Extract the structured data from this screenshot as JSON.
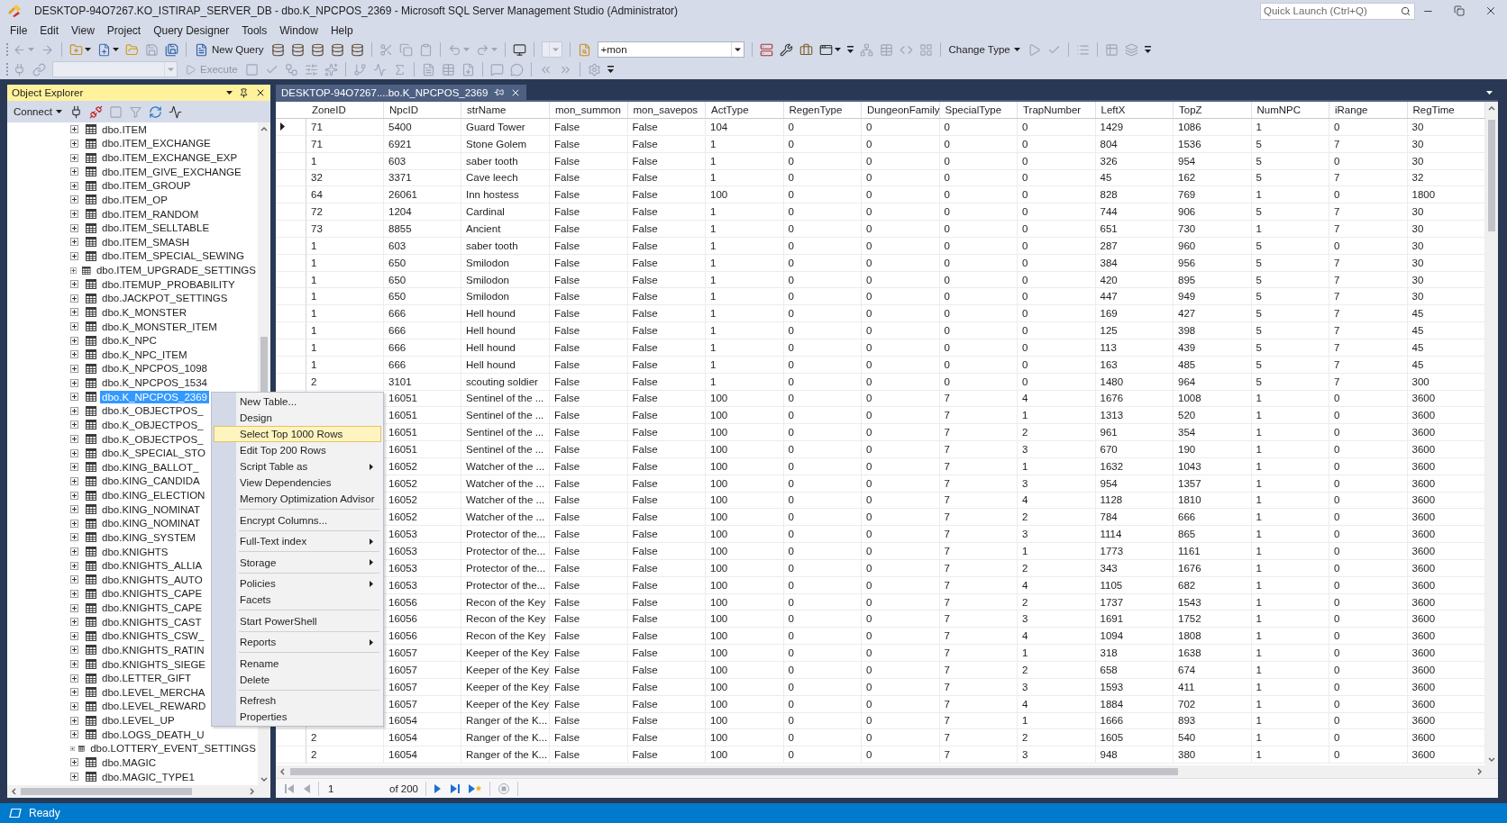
{
  "window": {
    "title": "DESKTOP-94O7267.KO_ISTIRAP_SERVER_DB - dbo.K_NPCPOS_2369 - Microsoft SQL Server Management Studio (Administrator)"
  },
  "quick_launch": {
    "placeholder": "Quick Launch (Ctrl+Q)"
  },
  "menu_bar": [
    "File",
    "Edit",
    "View",
    "Project",
    "Query Designer",
    "Tools",
    "Window",
    "Help"
  ],
  "toolbars": [
    {
      "items": [
        {
          "kind": "grip"
        },
        {
          "kind": "back",
          "disabled": true,
          "dropdown": true
        },
        {
          "kind": "forward",
          "disabled": true
        },
        {
          "kind": "separator"
        },
        {
          "kind": "newproject",
          "disabled": false,
          "dropdown": true
        },
        {
          "kind": "newitem",
          "disabled": false,
          "dropdown": true
        },
        {
          "kind": "open",
          "disabled": false
        },
        {
          "kind": "save",
          "disabled": true
        },
        {
          "kind": "saveall",
          "disabled": false
        },
        {
          "kind": "separator"
        },
        {
          "kind": "newquery",
          "label": "New Query",
          "disabled": false
        },
        {
          "kind": "database",
          "disabled": false
        },
        {
          "kind": "database",
          "disabled": false
        },
        {
          "kind": "database",
          "disabled": false
        },
        {
          "kind": "database",
          "disabled": false
        },
        {
          "kind": "database",
          "disabled": false
        },
        {
          "kind": "separator"
        },
        {
          "kind": "cut",
          "disabled": true
        },
        {
          "kind": "copy",
          "disabled": true
        },
        {
          "kind": "paste",
          "disabled": true
        },
        {
          "kind": "separator"
        },
        {
          "kind": "undo",
          "disabled": true,
          "dropdown": true
        },
        {
          "kind": "redo",
          "disabled": true,
          "dropdown": true
        },
        {
          "kind": "separator"
        },
        {
          "kind": "monitor",
          "disabled": false
        },
        {
          "kind": "separator"
        },
        {
          "kind": "smallcombo",
          "disabled": true
        },
        {
          "kind": "separator"
        },
        {
          "kind": "find",
          "disabled": false
        },
        {
          "kind": "combo",
          "value": "+mon",
          "disabled": false
        },
        {
          "kind": "separator"
        },
        {
          "kind": "server",
          "disabled": false
        },
        {
          "kind": "wrench",
          "disabled": false
        },
        {
          "kind": "toolbox",
          "disabled": false
        },
        {
          "kind": "window",
          "disabled": false,
          "dropdown": true
        },
        {
          "kind": "overflow"
        },
        {
          "kind": "diagram",
          "disabled": true
        },
        {
          "kind": "criteria",
          "disabled": true
        },
        {
          "kind": "sql",
          "disabled": true
        },
        {
          "kind": "results",
          "disabled": true
        },
        {
          "kind": "separator"
        },
        {
          "kind": "menubutton",
          "label": "Change Type",
          "disabled": false
        },
        {
          "kind": "run",
          "disabled": true
        },
        {
          "kind": "verify",
          "disabled": true
        },
        {
          "kind": "separator"
        },
        {
          "kind": "groupby",
          "disabled": true
        },
        {
          "kind": "separator"
        },
        {
          "kind": "addtable",
          "disabled": true
        },
        {
          "kind": "derived",
          "disabled": true
        },
        {
          "kind": "overflow"
        }
      ]
    },
    {
      "items": [
        {
          "kind": "grip"
        },
        {
          "kind": "connect",
          "disabled": true
        },
        {
          "kind": "changeconnection",
          "disabled": true
        },
        {
          "kind": "dbcombo",
          "disabled": true
        },
        {
          "kind": "execute",
          "label": "Execute",
          "disabled": true
        },
        {
          "kind": "stop",
          "disabled": true
        },
        {
          "kind": "parse",
          "disabled": true
        },
        {
          "kind": "plan",
          "disabled": true
        },
        {
          "kind": "options",
          "disabled": true
        },
        {
          "kind": "intellisense",
          "disabled": true
        },
        {
          "kind": "separator"
        },
        {
          "kind": "actualplan",
          "disabled": true
        },
        {
          "kind": "livestats",
          "disabled": true
        },
        {
          "kind": "clientstats",
          "disabled": true
        },
        {
          "kind": "separator"
        },
        {
          "kind": "totext",
          "disabled": true
        },
        {
          "kind": "togrid",
          "disabled": true
        },
        {
          "kind": "tofile",
          "disabled": true
        },
        {
          "kind": "separator"
        },
        {
          "kind": "comment",
          "disabled": true
        },
        {
          "kind": "uncomment",
          "disabled": true
        },
        {
          "kind": "separator"
        },
        {
          "kind": "outdent",
          "disabled": true
        },
        {
          "kind": "indent",
          "disabled": true
        },
        {
          "kind": "separator"
        },
        {
          "kind": "values",
          "disabled": true
        },
        {
          "kind": "overflow"
        }
      ]
    }
  ],
  "object_explorer": {
    "title": "Object Explorer",
    "toolbar": [
      {
        "kind": "connectmenu",
        "label": "Connect",
        "disabled": false
      },
      {
        "kind": "connect",
        "disabled": false
      },
      {
        "kind": "disconnect",
        "disabled": false
      },
      {
        "kind": "stop",
        "disabled": true
      },
      {
        "kind": "filter",
        "disabled": true
      },
      {
        "kind": "refresh",
        "disabled": false
      },
      {
        "kind": "activity",
        "disabled": false
      }
    ],
    "tree": [
      {
        "label": "dbo.ITEM",
        "expanded": false,
        "selected": false
      },
      {
        "label": "dbo.ITEM_EXCHANGE",
        "expanded": false,
        "selected": false
      },
      {
        "label": "dbo.ITEM_EXCHANGE_EXP",
        "expanded": false,
        "selected": false
      },
      {
        "label": "dbo.ITEM_GIVE_EXCHANGE",
        "expanded": false,
        "selected": false
      },
      {
        "label": "dbo.ITEM_GROUP",
        "expanded": false,
        "selected": false
      },
      {
        "label": "dbo.ITEM_OP",
        "expanded": false,
        "selected": false
      },
      {
        "label": "dbo.ITEM_RANDOM",
        "expanded": false,
        "selected": false
      },
      {
        "label": "dbo.ITEM_SELLTABLE",
        "expanded": false,
        "selected": false
      },
      {
        "label": "dbo.ITEM_SMASH",
        "expanded": false,
        "selected": false
      },
      {
        "label": "dbo.ITEM_SPECIAL_SEWING",
        "expanded": false,
        "selected": false
      },
      {
        "label": "dbo.ITEM_UPGRADE_SETTINGS",
        "expanded": false,
        "selected": false
      },
      {
        "label": "dbo.ITEMUP_PROBABILITY",
        "expanded": false,
        "selected": false
      },
      {
        "label": "dbo.JACKPOT_SETTINGS",
        "expanded": false,
        "selected": false
      },
      {
        "label": "dbo.K_MONSTER",
        "expanded": false,
        "selected": false
      },
      {
        "label": "dbo.K_MONSTER_ITEM",
        "expanded": false,
        "selected": false
      },
      {
        "label": "dbo.K_NPC",
        "expanded": false,
        "selected": false
      },
      {
        "label": "dbo.K_NPC_ITEM",
        "expanded": false,
        "selected": false
      },
      {
        "label": "dbo.K_NPCPOS_1098",
        "expanded": false,
        "selected": false
      },
      {
        "label": "dbo.K_NPCPOS_1534",
        "expanded": false,
        "selected": false
      },
      {
        "label": "dbo.K_NPCPOS_2369",
        "expanded": false,
        "selected": true
      },
      {
        "label": "dbo.K_OBJECTPOS_",
        "expanded": false,
        "selected": false
      },
      {
        "label": "dbo.K_OBJECTPOS_",
        "expanded": false,
        "selected": false
      },
      {
        "label": "dbo.K_OBJECTPOS_",
        "expanded": false,
        "selected": false
      },
      {
        "label": "dbo.K_SPECIAL_STO",
        "expanded": false,
        "selected": false
      },
      {
        "label": "dbo.KING_BALLOT_",
        "expanded": false,
        "selected": false
      },
      {
        "label": "dbo.KING_CANDIDA",
        "expanded": false,
        "selected": false
      },
      {
        "label": "dbo.KING_ELECTION",
        "expanded": false,
        "selected": false
      },
      {
        "label": "dbo.KING_NOMINAT",
        "expanded": false,
        "selected": false
      },
      {
        "label": "dbo.KING_NOMINAT",
        "expanded": false,
        "selected": false
      },
      {
        "label": "dbo.KING_SYSTEM",
        "expanded": false,
        "selected": false
      },
      {
        "label": "dbo.KNIGHTS",
        "expanded": false,
        "selected": false
      },
      {
        "label": "dbo.KNIGHTS_ALLIA",
        "expanded": false,
        "selected": false
      },
      {
        "label": "dbo.KNIGHTS_AUTO",
        "expanded": false,
        "selected": false
      },
      {
        "label": "dbo.KNIGHTS_CAPE",
        "expanded": false,
        "selected": false
      },
      {
        "label": "dbo.KNIGHTS_CAPE",
        "expanded": false,
        "selected": false
      },
      {
        "label": "dbo.KNIGHTS_CAST",
        "expanded": false,
        "selected": false
      },
      {
        "label": "dbo.KNIGHTS_CSW_",
        "expanded": false,
        "selected": false
      },
      {
        "label": "dbo.KNIGHTS_RATIN",
        "expanded": false,
        "selected": false
      },
      {
        "label": "dbo.KNIGHTS_SIEGE",
        "expanded": false,
        "selected": false
      },
      {
        "label": "dbo.LETTER_GIFT",
        "expanded": false,
        "selected": false
      },
      {
        "label": "dbo.LEVEL_MERCHA",
        "expanded": false,
        "selected": false
      },
      {
        "label": "dbo.LEVEL_REWARD",
        "expanded": false,
        "selected": false
      },
      {
        "label": "dbo.LEVEL_UP",
        "expanded": false,
        "selected": false
      },
      {
        "label": "dbo.LOGS_DEATH_U",
        "expanded": false,
        "selected": false
      },
      {
        "label": "dbo.LOTTERY_EVENT_SETTINGS",
        "expanded": false,
        "selected": false
      },
      {
        "label": "dbo.MAGIC",
        "expanded": false,
        "selected": false
      },
      {
        "label": "dbo.MAGIC_TYPE1",
        "expanded": false,
        "selected": false
      }
    ]
  },
  "document": {
    "tab": {
      "label": "DESKTOP-94O7267....bo.K_NPCPOS_2369",
      "selected": true
    },
    "grid": {
      "columns": [
        "ZoneID",
        "NpcID",
        "strName",
        "mon_summon",
        "mon_savepos",
        "ActType",
        "RegenType",
        "DungeonFamily",
        "SpecialType",
        "TrapNumber",
        "LeftX",
        "TopZ",
        "NumNPC",
        "iRange",
        "RegTime"
      ],
      "rows": [
        {
          "current": true,
          "cells": [
            "71",
            "5400",
            "Guard Tower",
            "False",
            "False",
            "104",
            "0",
            "0",
            "0",
            "0",
            "1429",
            "1086",
            "1",
            "0",
            "30"
          ]
        },
        {
          "current": false,
          "cells": [
            "71",
            "6921",
            "Stone Golem",
            "False",
            "False",
            "1",
            "0",
            "0",
            "0",
            "0",
            "804",
            "1536",
            "5",
            "7",
            "30"
          ]
        },
        {
          "current": false,
          "cells": [
            "1",
            "603",
            "saber tooth",
            "False",
            "False",
            "1",
            "0",
            "0",
            "0",
            "0",
            "326",
            "954",
            "5",
            "0",
            "30"
          ]
        },
        {
          "current": false,
          "cells": [
            "32",
            "3371",
            "Cave leech",
            "False",
            "False",
            "1",
            "0",
            "0",
            "0",
            "0",
            "45",
            "162",
            "5",
            "7",
            "32"
          ]
        },
        {
          "current": false,
          "cells": [
            "64",
            "26061",
            "Inn hostess",
            "False",
            "False",
            "100",
            "0",
            "0",
            "0",
            "0",
            "828",
            "769",
            "1",
            "0",
            "1800"
          ]
        },
        {
          "current": false,
          "cells": [
            "72",
            "1204",
            "Cardinal",
            "False",
            "False",
            "1",
            "0",
            "0",
            "0",
            "0",
            "744",
            "906",
            "5",
            "7",
            "30"
          ]
        },
        {
          "current": false,
          "cells": [
            "73",
            "8855",
            "Ancient",
            "False",
            "False",
            "1",
            "0",
            "0",
            "0",
            "0",
            "651",
            "730",
            "1",
            "7",
            "30"
          ]
        },
        {
          "current": false,
          "cells": [
            "1",
            "603",
            "saber tooth",
            "False",
            "False",
            "1",
            "0",
            "0",
            "0",
            "0",
            "287",
            "960",
            "5",
            "0",
            "30"
          ]
        },
        {
          "current": false,
          "cells": [
            "1",
            "650",
            "Smilodon",
            "False",
            "False",
            "1",
            "0",
            "0",
            "0",
            "0",
            "384",
            "956",
            "5",
            "7",
            "30"
          ]
        },
        {
          "current": false,
          "cells": [
            "1",
            "650",
            "Smilodon",
            "False",
            "False",
            "1",
            "0",
            "0",
            "0",
            "0",
            "420",
            "895",
            "5",
            "7",
            "30"
          ]
        },
        {
          "current": false,
          "cells": [
            "1",
            "650",
            "Smilodon",
            "False",
            "False",
            "1",
            "0",
            "0",
            "0",
            "0",
            "447",
            "949",
            "5",
            "7",
            "30"
          ]
        },
        {
          "current": false,
          "cells": [
            "1",
            "666",
            "Hell hound",
            "False",
            "False",
            "1",
            "0",
            "0",
            "0",
            "0",
            "169",
            "427",
            "5",
            "7",
            "45"
          ]
        },
        {
          "current": false,
          "cells": [
            "1",
            "666",
            "Hell hound",
            "False",
            "False",
            "1",
            "0",
            "0",
            "0",
            "0",
            "125",
            "398",
            "5",
            "7",
            "45"
          ]
        },
        {
          "current": false,
          "cells": [
            "1",
            "666",
            "Hell hound",
            "False",
            "False",
            "1",
            "0",
            "0",
            "0",
            "0",
            "113",
            "439",
            "5",
            "7",
            "45"
          ]
        },
        {
          "current": false,
          "cells": [
            "1",
            "666",
            "Hell hound",
            "False",
            "False",
            "1",
            "0",
            "0",
            "0",
            "0",
            "163",
            "485",
            "5",
            "7",
            "45"
          ]
        },
        {
          "current": false,
          "cells": [
            "2",
            "3101",
            "scouting soldier",
            "False",
            "False",
            "1",
            "0",
            "0",
            "0",
            "0",
            "1480",
            "964",
            "5",
            "7",
            "300"
          ]
        },
        {
          "cells": [
            "",
            "16051",
            "Sentinel of the ...",
            "False",
            "False",
            "100",
            "0",
            "0",
            "7",
            "4",
            "1676",
            "1008",
            "1",
            "0",
            "3600"
          ]
        },
        {
          "cells": [
            "",
            "16051",
            "Sentinel of the ...",
            "False",
            "False",
            "100",
            "0",
            "0",
            "7",
            "1",
            "1313",
            "520",
            "1",
            "0",
            "3600"
          ]
        },
        {
          "cells": [
            "",
            "16051",
            "Sentinel of the ...",
            "False",
            "False",
            "100",
            "0",
            "0",
            "7",
            "2",
            "961",
            "354",
            "1",
            "0",
            "3600"
          ]
        },
        {
          "cells": [
            "",
            "16051",
            "Sentinel of the ...",
            "False",
            "False",
            "100",
            "0",
            "0",
            "7",
            "3",
            "670",
            "190",
            "1",
            "0",
            "3600"
          ]
        },
        {
          "cells": [
            "",
            "16052",
            "Watcher of the ...",
            "False",
            "False",
            "100",
            "0",
            "0",
            "7",
            "1",
            "1632",
            "1043",
            "1",
            "0",
            "3600"
          ]
        },
        {
          "cells": [
            "",
            "16052",
            "Watcher of the ...",
            "False",
            "False",
            "100",
            "0",
            "0",
            "7",
            "3",
            "954",
            "1357",
            "1",
            "0",
            "3600"
          ]
        },
        {
          "cells": [
            "",
            "16052",
            "Watcher of the ...",
            "False",
            "False",
            "100",
            "0",
            "0",
            "7",
            "4",
            "1128",
            "1810",
            "1",
            "0",
            "3600"
          ]
        },
        {
          "cells": [
            "",
            "16052",
            "Watcher of the ...",
            "False",
            "False",
            "100",
            "0",
            "0",
            "7",
            "2",
            "784",
            "666",
            "1",
            "0",
            "3600"
          ]
        },
        {
          "cells": [
            "",
            "16053",
            "Protector of the...",
            "False",
            "False",
            "100",
            "0",
            "0",
            "7",
            "3",
            "1114",
            "865",
            "1",
            "0",
            "3600"
          ]
        },
        {
          "cells": [
            "",
            "16053",
            "Protector of the...",
            "False",
            "False",
            "100",
            "0",
            "0",
            "7",
            "1",
            "1773",
            "1161",
            "1",
            "0",
            "3600"
          ]
        },
        {
          "cells": [
            "",
            "16053",
            "Protector of the...",
            "False",
            "False",
            "100",
            "0",
            "0",
            "7",
            "2",
            "343",
            "1676",
            "1",
            "0",
            "3600"
          ]
        },
        {
          "cells": [
            "",
            "16053",
            "Protector of the...",
            "False",
            "False",
            "100",
            "0",
            "0",
            "7",
            "4",
            "1105",
            "682",
            "1",
            "0",
            "3600"
          ]
        },
        {
          "cells": [
            "",
            "16056",
            "Recon of the Key",
            "False",
            "False",
            "100",
            "0",
            "0",
            "7",
            "2",
            "1737",
            "1543",
            "1",
            "0",
            "3600"
          ]
        },
        {
          "cells": [
            "",
            "16056",
            "Recon of the Key",
            "False",
            "False",
            "100",
            "0",
            "0",
            "7",
            "3",
            "1691",
            "1752",
            "1",
            "0",
            "3600"
          ]
        },
        {
          "cells": [
            "",
            "16056",
            "Recon of the Key",
            "False",
            "False",
            "100",
            "0",
            "0",
            "7",
            "4",
            "1094",
            "1808",
            "1",
            "0",
            "3600"
          ]
        },
        {
          "cells": [
            "",
            "16057",
            "Keeper of the Key",
            "False",
            "False",
            "100",
            "0",
            "0",
            "7",
            "1",
            "318",
            "1638",
            "1",
            "0",
            "3600"
          ]
        },
        {
          "cells": [
            "",
            "16057",
            "Keeper of the Key",
            "False",
            "False",
            "100",
            "0",
            "0",
            "7",
            "2",
            "658",
            "674",
            "1",
            "0",
            "3600"
          ]
        },
        {
          "cells": [
            "",
            "16057",
            "Keeper of the Key",
            "False",
            "False",
            "100",
            "0",
            "0",
            "7",
            "3",
            "1593",
            "411",
            "1",
            "0",
            "3600"
          ]
        },
        {
          "cells": [
            "",
            "16057",
            "Keeper of the Key",
            "False",
            "False",
            "100",
            "0",
            "0",
            "7",
            "4",
            "1884",
            "702",
            "1",
            "0",
            "3600"
          ]
        },
        {
          "cells": [
            "",
            "16054",
            "Ranger of the K...",
            "False",
            "False",
            "100",
            "0",
            "0",
            "7",
            "1",
            "1666",
            "893",
            "1",
            "0",
            "3600"
          ]
        },
        {
          "current": false,
          "cells": [
            "2",
            "16054",
            "Ranger of the K...",
            "False",
            "False",
            "100",
            "0",
            "0",
            "7",
            "2",
            "1605",
            "540",
            "1",
            "0",
            "3600"
          ]
        },
        {
          "current": false,
          "cells": [
            "2",
            "16054",
            "Ranger of the K...",
            "False",
            "False",
            "100",
            "0",
            "0",
            "7",
            "3",
            "948",
            "380",
            "1",
            "0",
            "3600"
          ]
        }
      ]
    },
    "navigator": {
      "items": [
        {
          "kind": "first",
          "disabled": true
        },
        {
          "kind": "previous",
          "disabled": true
        },
        {
          "kind": "separator"
        },
        {
          "kind": "field",
          "value": "1"
        },
        {
          "kind": "label",
          "text": "of 200"
        },
        {
          "kind": "separator"
        },
        {
          "kind": "next",
          "disabled": false
        },
        {
          "kind": "last",
          "disabled": false
        },
        {
          "kind": "addnew",
          "disabled": false
        },
        {
          "kind": "separator"
        },
        {
          "kind": "stop",
          "disabled": true
        },
        {
          "kind": "separator"
        }
      ]
    }
  },
  "context_menu": {
    "items": [
      {
        "kind": "item",
        "label": "New Table...",
        "submenu": false,
        "selected": false
      },
      {
        "kind": "item",
        "label": "Design",
        "submenu": false,
        "selected": false
      },
      {
        "kind": "item",
        "label": "Select Top 1000 Rows",
        "submenu": false,
        "selected": true
      },
      {
        "kind": "item",
        "label": "Edit Top 200 Rows",
        "submenu": false,
        "selected": false
      },
      {
        "kind": "item",
        "label": "Script Table as",
        "submenu": true,
        "selected": false
      },
      {
        "kind": "item",
        "label": "View Dependencies",
        "submenu": false,
        "selected": false
      },
      {
        "kind": "item",
        "label": "Memory Optimization Advisor",
        "submenu": false,
        "selected": false
      },
      {
        "kind": "separator"
      },
      {
        "kind": "item",
        "label": "Encrypt Columns...",
        "submenu": false,
        "selected": false
      },
      {
        "kind": "separator"
      },
      {
        "kind": "item",
        "label": "Full-Text index",
        "submenu": true,
        "selected": false
      },
      {
        "kind": "separator"
      },
      {
        "kind": "item",
        "label": "Storage",
        "submenu": true,
        "selected": false
      },
      {
        "kind": "separator"
      },
      {
        "kind": "item",
        "label": "Policies",
        "submenu": true,
        "selected": false
      },
      {
        "kind": "item",
        "label": "Facets",
        "submenu": false,
        "selected": false
      },
      {
        "kind": "separator"
      },
      {
        "kind": "item",
        "label": "Start PowerShell",
        "submenu": false,
        "selected": false
      },
      {
        "kind": "separator"
      },
      {
        "kind": "item",
        "label": "Reports",
        "submenu": true,
        "selected": false
      },
      {
        "kind": "separator"
      },
      {
        "kind": "item",
        "label": "Rename",
        "submenu": false,
        "selected": false
      },
      {
        "kind": "item",
        "label": "Delete",
        "submenu": false,
        "selected": false
      },
      {
        "kind": "separator"
      },
      {
        "kind": "item",
        "label": "Refresh",
        "submenu": false,
        "selected": false
      },
      {
        "kind": "item",
        "label": "Properties",
        "submenu": false,
        "selected": false
      }
    ]
  },
  "status_bar": {
    "text": "Ready"
  }
}
